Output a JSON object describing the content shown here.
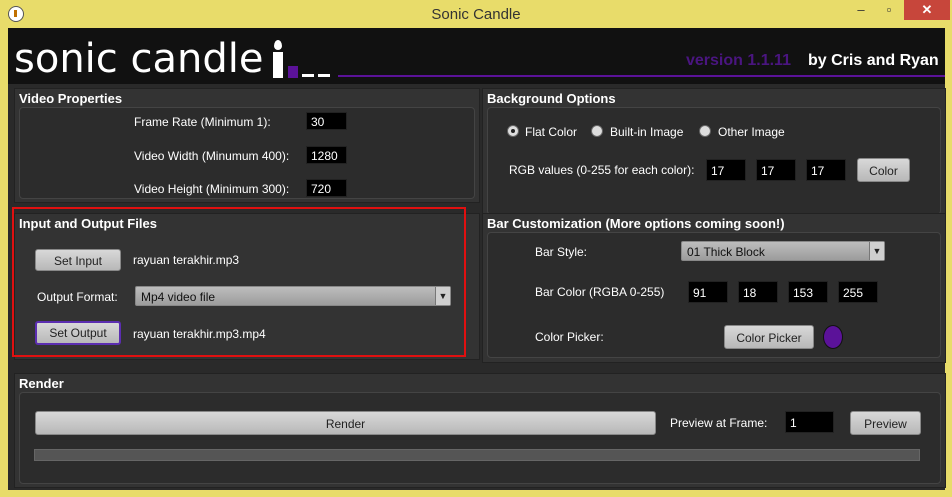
{
  "window": {
    "title": "Sonic Candle",
    "minimize": "–",
    "maximize": "▫",
    "close": "✕"
  },
  "header": {
    "logo": "sonic candle",
    "version": "version 1.1.11",
    "credits": "by Cris and Ryan"
  },
  "video_properties": {
    "title": "Video Properties",
    "frame_rate_label": "Frame Rate (Minimum 1):",
    "frame_rate": "30",
    "width_label": "Video Width (Minumum 400):",
    "width": "1280",
    "height_label": "Video Height (Minimum 300):",
    "height": "720"
  },
  "background_options": {
    "title": "Background Options",
    "options": [
      "Flat Color",
      "Built-in Image",
      "Other Image"
    ],
    "selected": "Flat Color",
    "rgb_label": "RGB values (0-255 for each color):",
    "rgb": [
      "17",
      "17",
      "17"
    ],
    "color_button": "Color"
  },
  "io_files": {
    "title": "Input and Output Files",
    "set_input": "Set Input",
    "input_file": "rayuan terakhir.mp3",
    "format_label": "Output Format:",
    "format": "Mp4 video file",
    "set_output": "Set Output",
    "output_file": "rayuan terakhir.mp3.mp4"
  },
  "bar_customization": {
    "title": "Bar Customization (More options coming soon!)",
    "style_label": "Bar Style:",
    "style": "01 Thick Block",
    "color_label": "Bar Color (RGBA 0-255)",
    "rgba": [
      "91",
      "18",
      "153",
      "255"
    ],
    "picker_label": "Color Picker:",
    "picker_button": "Color Picker",
    "swatch_color": "#5b1299"
  },
  "render": {
    "title": "Render",
    "render_button": "Render",
    "preview_label": "Preview at Frame:",
    "preview_frame": "1",
    "preview_button": "Preview",
    "progress": 0
  }
}
